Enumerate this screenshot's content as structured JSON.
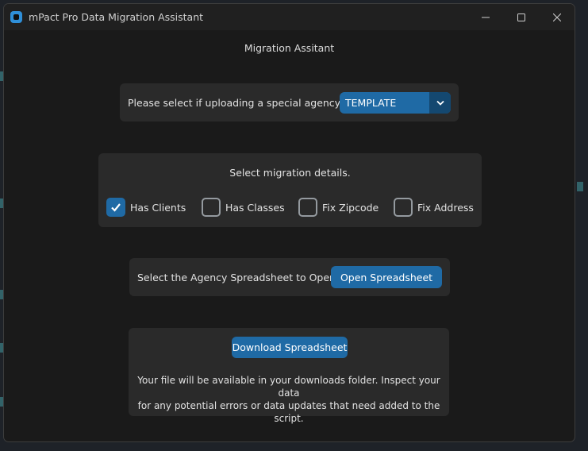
{
  "window": {
    "title": "mPact Pro Data Migration Assistant"
  },
  "heading": "Migration Assitant",
  "agency": {
    "prompt": "Please select if uploading a special agency.",
    "selected": "TEMPLATE"
  },
  "details": {
    "prompt": "Select migration details.",
    "options": [
      {
        "label": "Has Clients",
        "checked": true
      },
      {
        "label": "Has Classes",
        "checked": false
      },
      {
        "label": "Fix Zipcode",
        "checked": false
      },
      {
        "label": "Fix Address",
        "checked": false
      }
    ]
  },
  "open": {
    "prompt": "Select the Agency Spreadsheet to Open",
    "button": "Open Spreadsheet"
  },
  "download": {
    "button": "Download Spreadsheet",
    "info_line1": "Your file will be available in your downloads folder. Inspect your data",
    "info_line2": "for any potential errors or data updates that need added to the script."
  },
  "colors": {
    "accent": "#1f6aa5",
    "panel": "#2a2a2a",
    "window": "#1a1a1a"
  }
}
